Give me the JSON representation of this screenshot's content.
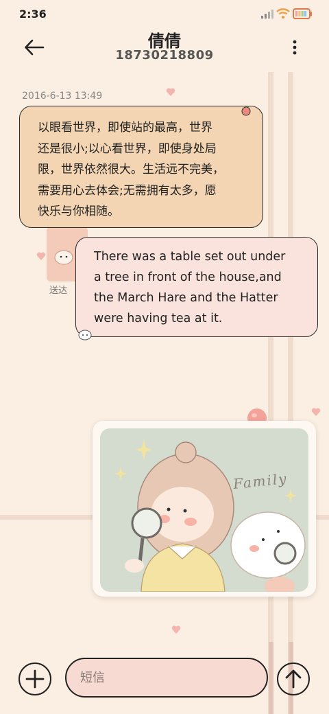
{
  "status_bar": {
    "time": "2:36",
    "icons": [
      "signal-icon",
      "wifi-icon",
      "battery-icon"
    ]
  },
  "header": {
    "contact_name": "倩倩",
    "phone_number": "18730218809",
    "back_icon": "arrow-left-icon",
    "menu_icon": "more-vertical-icon"
  },
  "conversation": {
    "timestamp": "2016-6-13 13:49",
    "messages": [
      {
        "direction": "incoming",
        "lines": [
          "以眼看世界，即使站的最高，世界",
          "还是很小;以心看世界，即使身处局",
          "限，世界依然很大。生活远不完美，",
          "需要用心去体会;无需拥有太多，愿",
          "快乐与你相随。"
        ]
      },
      {
        "direction": "outgoing",
        "lines": [
          "There was a table set out under",
          "a tree in front of the house,and",
          "the March Hare and the Hatter",
          "were having tea at it."
        ],
        "status": "送达"
      }
    ],
    "image_caption": "Family"
  },
  "compose": {
    "placeholder": "短信",
    "add_icon": "plus-icon",
    "send_icon": "arrow-up-icon"
  },
  "colors": {
    "background": "#fbeee2",
    "incoming_bubble": "#f3d5b3",
    "outgoing_bubble": "#fbe3dd",
    "input_fill": "#f7dbd2"
  }
}
